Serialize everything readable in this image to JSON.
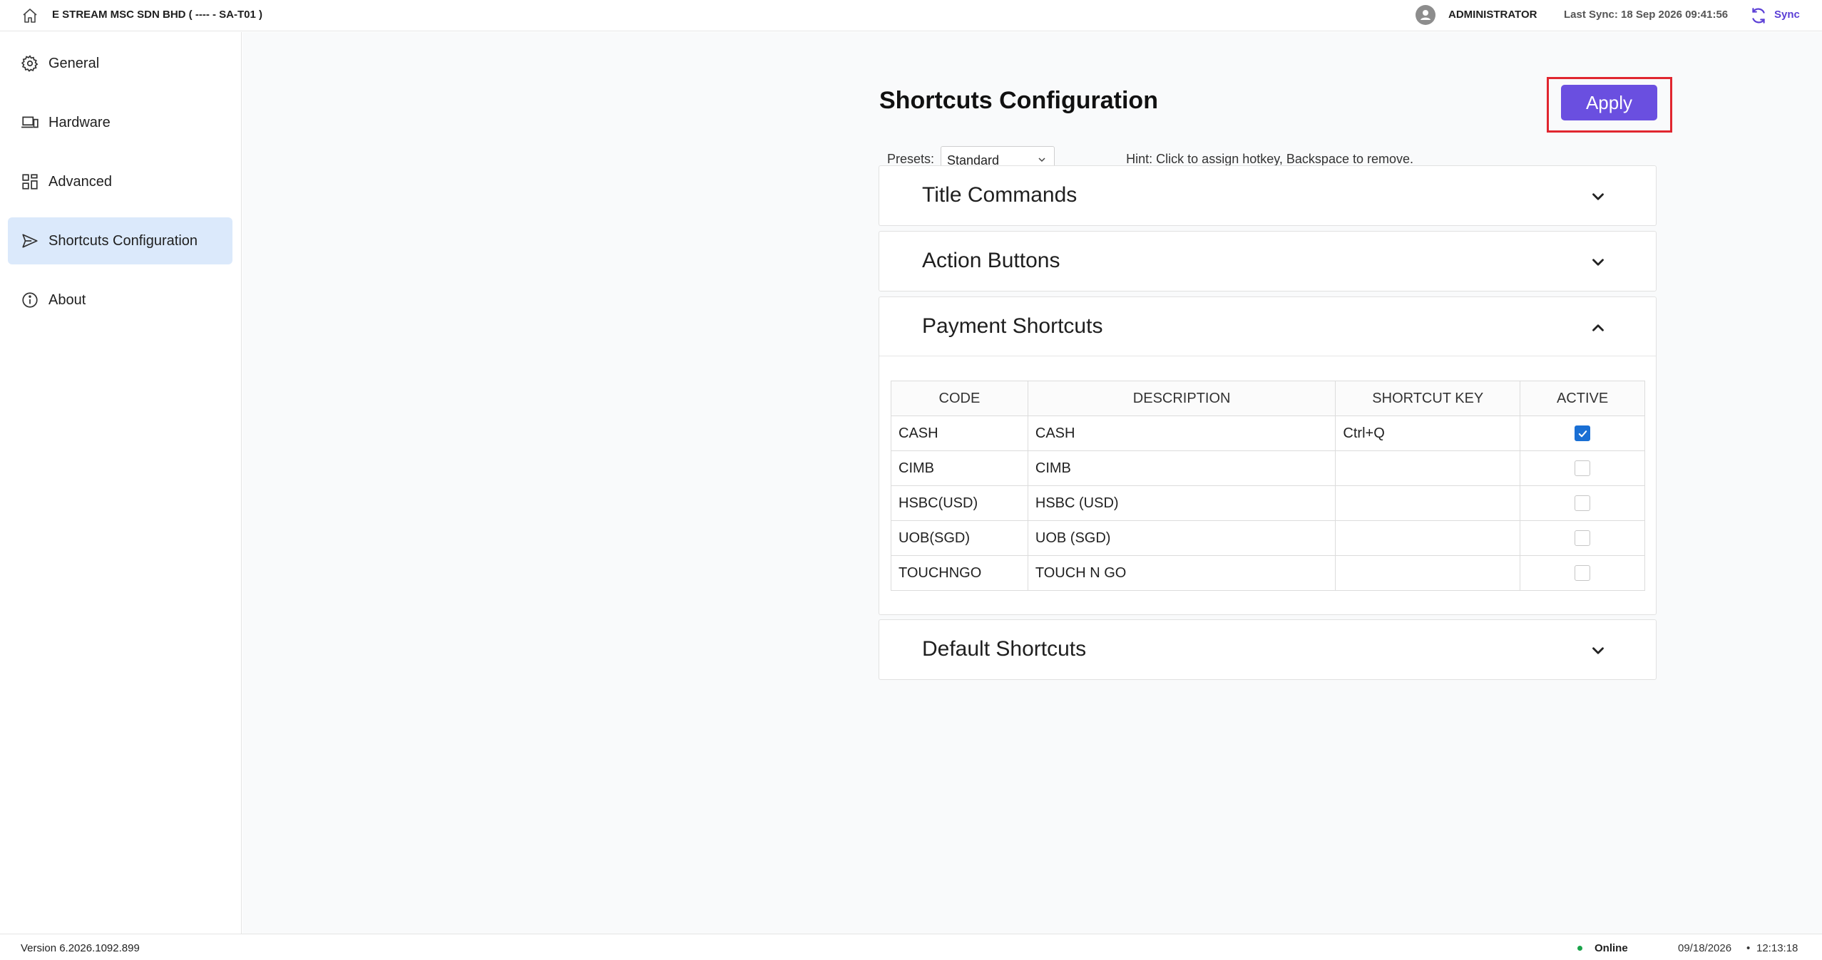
{
  "topbar": {
    "company": "E STREAM MSC SDN BHD ( ---- - SA-T01 )",
    "user": "ADMINISTRATOR",
    "last_sync": "Last Sync: 18 Sep 2026 09:41:56",
    "sync_label": "Sync",
    "accent": "#5b3fd6"
  },
  "sidebar": {
    "items": [
      {
        "label": "General",
        "icon": "gear-icon"
      },
      {
        "label": "Hardware",
        "icon": "devices-icon"
      },
      {
        "label": "Advanced",
        "icon": "grid-icon"
      },
      {
        "label": "Shortcuts Configuration",
        "icon": "send-icon",
        "active": true
      },
      {
        "label": "About",
        "icon": "info-icon"
      }
    ]
  },
  "main": {
    "title": "Shortcuts Configuration",
    "apply_label": "Apply",
    "presets_label": "Presets:",
    "presets_value": "Standard",
    "hint": "Hint: Click to assign hotkey, Backspace to remove."
  },
  "sections": [
    {
      "title": "Title Commands",
      "expanded": false
    },
    {
      "title": "Action Buttons",
      "expanded": false
    },
    {
      "title": "Payment Shortcuts",
      "expanded": true
    },
    {
      "title": "Default Shortcuts",
      "expanded": false
    }
  ],
  "payment_table": {
    "columns": [
      "CODE",
      "DESCRIPTION",
      "SHORTCUT KEY",
      "ACTIVE"
    ],
    "rows": [
      {
        "code": "CASH",
        "description": "CASH",
        "shortcut": "Ctrl+Q",
        "active": true
      },
      {
        "code": "CIMB",
        "description": "CIMB",
        "shortcut": "",
        "active": false
      },
      {
        "code": "HSBC(USD)",
        "description": "HSBC (USD)",
        "shortcut": "",
        "active": false
      },
      {
        "code": "UOB(SGD)",
        "description": "UOB (SGD)",
        "shortcut": "",
        "active": false
      },
      {
        "code": "TOUCHNGO",
        "description": "TOUCH N GO",
        "shortcut": "",
        "active": false
      }
    ]
  },
  "footer": {
    "version": "Version 6.2026.1092.899",
    "status": "Online",
    "date": "09/18/2026",
    "separator": "•",
    "time": "12:13:18"
  },
  "colors": {
    "primary_button": "#6a4fe0",
    "highlight_border": "#e0262f",
    "checkbox_checked": "#1a6fd4",
    "active_nav_bg": "#dbe9fb",
    "online": "#1aa34a"
  }
}
